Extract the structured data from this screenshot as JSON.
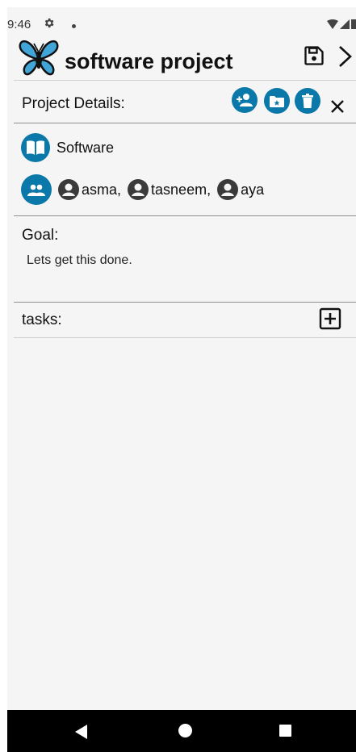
{
  "status": {
    "time": "9:46"
  },
  "app": {
    "title": "software project"
  },
  "details": {
    "header": "Project Details:"
  },
  "project": {
    "category": "Software"
  },
  "members": [
    {
      "label": "asma,"
    },
    {
      "label": "tasneem,"
    },
    {
      "label": "aya"
    }
  ],
  "goal": {
    "label": "Goal:",
    "text": "Lets get this done."
  },
  "tasks": {
    "label": "tasks:"
  },
  "icons": {
    "logo": "butterfly-logo",
    "save": "save-icon",
    "next": "chevron-right-icon",
    "add_member": "add-person-icon",
    "folder": "folder-star-icon",
    "delete": "trash-icon",
    "close": "close-icon",
    "category": "book-icon",
    "members": "group-icon",
    "person": "account-circle-icon",
    "add_task": "add-box-icon"
  },
  "colors": {
    "accent": "#0a78a8",
    "background": "#f5f5f5",
    "logo_blue": "#42a5d8"
  }
}
